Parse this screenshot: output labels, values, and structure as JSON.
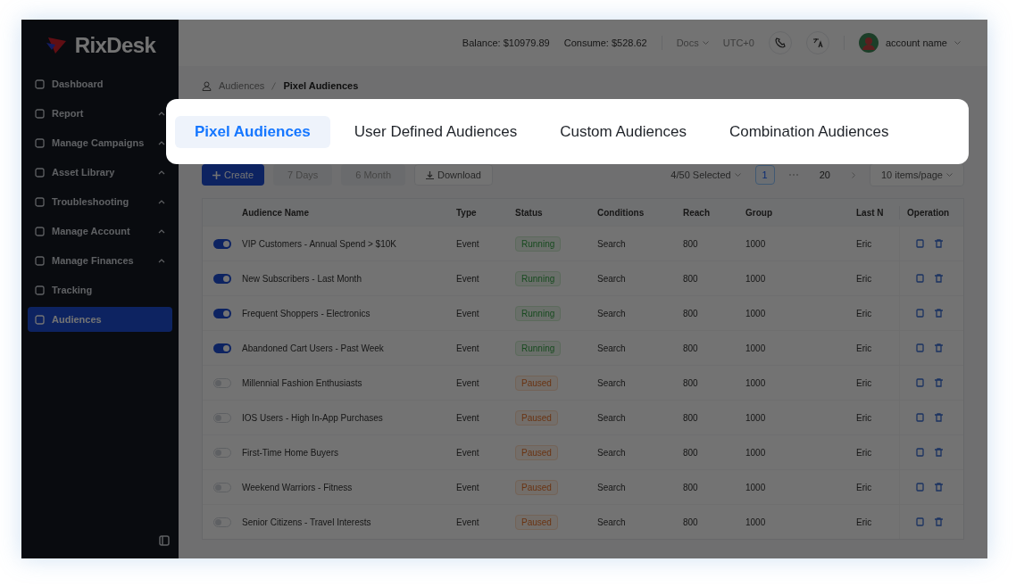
{
  "sidebar": {
    "logo": "RixDesk",
    "items": [
      {
        "label": "Dashboard",
        "expandable": false,
        "selected": false
      },
      {
        "label": "Report",
        "expandable": true,
        "selected": false
      },
      {
        "label": "Manage Campaigns",
        "expandable": true,
        "selected": false
      },
      {
        "label": "Asset Library",
        "expandable": true,
        "selected": false
      },
      {
        "label": "Troubleshooting",
        "expandable": true,
        "selected": false
      },
      {
        "label": "Manage Account",
        "expandable": true,
        "selected": false
      },
      {
        "label": "Manage Finances",
        "expandable": true,
        "selected": false
      },
      {
        "label": "Tracking",
        "expandable": false,
        "selected": false
      },
      {
        "label": "Audiences",
        "expandable": false,
        "selected": true
      }
    ]
  },
  "header": {
    "balance": "Balance: $10979.89",
    "consume": "Consume: $528.62",
    "docs": "Docs",
    "timezone": "UTC+0",
    "account_name": "account name"
  },
  "breadcrumb": [
    "Audiences",
    "Pixel Audiences"
  ],
  "tabs": [
    {
      "label": "Pixel Audiences",
      "selected": true
    },
    {
      "label": "User Defined Audiences",
      "selected": false
    },
    {
      "label": "Custom Audiences",
      "selected": false
    },
    {
      "label": "Combination Audiences",
      "selected": false
    }
  ],
  "toolbar": {
    "buttons": [
      {
        "label": "Create",
        "kind": "primary"
      },
      {
        "label": "7 Days",
        "kind": "plain"
      },
      {
        "label": "6 Month",
        "kind": "plain"
      },
      {
        "label": "Download",
        "kind": "download"
      }
    ],
    "selection": "4/50 Selected",
    "page": "1",
    "page_count": "20",
    "page_size": "10 items/page"
  },
  "table": {
    "columns": [
      "Audience Name",
      "Type",
      "Status",
      "Conditions",
      "Reach",
      "Group",
      "Last N",
      "Operation"
    ],
    "rows": [
      {
        "on": true,
        "name": "VIP Customers - Annual Spend > $10K",
        "type": "Event",
        "status": "Running",
        "kind": "running",
        "conditions": "Search",
        "reach": "800",
        "group": "1000",
        "last": "Eric"
      },
      {
        "on": true,
        "name": "New Subscribers - Last Month",
        "type": "Event",
        "status": "Running",
        "kind": "running",
        "conditions": "Search",
        "reach": "800",
        "group": "1000",
        "last": "Eric"
      },
      {
        "on": true,
        "name": "Frequent Shoppers - Electronics",
        "type": "Event",
        "status": "Running",
        "kind": "running",
        "conditions": "Search",
        "reach": "800",
        "group": "1000",
        "last": "Eric"
      },
      {
        "on": true,
        "name": "Abandoned Cart Users - Past Week",
        "type": "Event",
        "status": "Running",
        "kind": "running",
        "conditions": "Search",
        "reach": "800",
        "group": "1000",
        "last": "Eric"
      },
      {
        "on": false,
        "name": "Millennial Fashion Enthusiasts",
        "type": "Event",
        "status": "Paused",
        "kind": "paused",
        "conditions": "Search",
        "reach": "800",
        "group": "1000",
        "last": "Eric"
      },
      {
        "on": false,
        "name": "IOS Users - High In-App Purchases",
        "type": "Event",
        "status": "Paused",
        "kind": "paused",
        "conditions": "Search",
        "reach": "800",
        "group": "1000",
        "last": "Eric"
      },
      {
        "on": false,
        "name": "First-Time Home Buyers",
        "type": "Event",
        "status": "Paused",
        "kind": "paused",
        "conditions": "Search",
        "reach": "800",
        "group": "1000",
        "last": "Eric"
      },
      {
        "on": false,
        "name": "Weekend Warriors - Fitness",
        "type": "Event",
        "status": "Paused",
        "kind": "paused",
        "conditions": "Search",
        "reach": "800",
        "group": "1000",
        "last": "Eric"
      },
      {
        "on": false,
        "name": "Senior Citizens - Travel Interests",
        "type": "Event",
        "status": "Paused",
        "kind": "paused",
        "conditions": "Search",
        "reach": "800",
        "group": "1000",
        "last": "Eric"
      }
    ]
  }
}
